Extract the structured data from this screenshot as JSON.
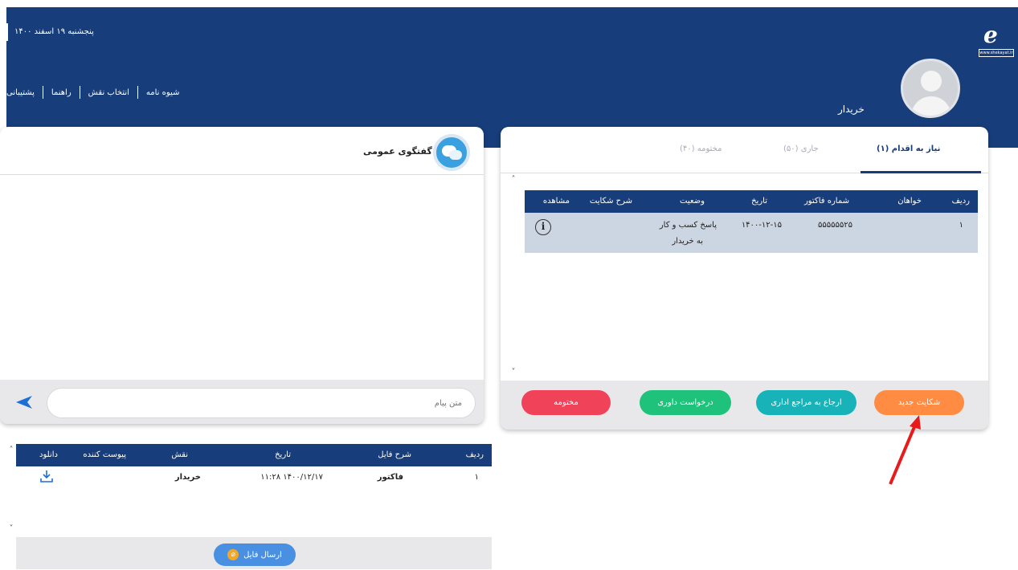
{
  "header": {
    "date": "پنجشنبه ۱۹ اسفند ۱۴۰۰",
    "nav": [
      "پشتیبانی",
      "راهنما",
      "انتخاب نقش",
      "شیوه نامه"
    ],
    "role": "خریدار",
    "logo_text": "www.shekayat.ir",
    "bg_color": "#173d7a"
  },
  "complaints": {
    "tabs": [
      {
        "label": "نیاز به اقدام (۱)",
        "active": true
      },
      {
        "label": "جاری (۵۰)",
        "active": false
      },
      {
        "label": "مختومه (۴۰)",
        "active": false
      }
    ],
    "columns": [
      "ردیف",
      "خواهان",
      "شماره فاکتور",
      "تاریخ",
      "وضعیت",
      "شرح شکایت",
      "مشاهده"
    ],
    "rows": [
      {
        "index": "۱",
        "plaintiff": "",
        "invoice": "۵۵۵۵۵۵۲۵",
        "date": "۱۴۰۰-۱۲-۱۵",
        "status_line1": "پاسخ کسب و کار",
        "status_line2": "به خریدار",
        "description": "",
        "view_icon": "info-icon"
      }
    ],
    "buttons": [
      {
        "label": "شکایت جدید",
        "color": "#ff8c42"
      },
      {
        "label": "ارجاع به مراجع اداری",
        "color": "#17b3b8"
      },
      {
        "label": "درخواست داوری",
        "color": "#1ec27a"
      },
      {
        "label": "مختومه",
        "color": "#f0435a"
      }
    ]
  },
  "chat": {
    "title": "گفتگوی عمومی",
    "placeholder": "متن پیام"
  },
  "files": {
    "columns": [
      "ردیف",
      "شرح فایل",
      "تاریخ",
      "نقش",
      "پیوست کننده",
      "دانلود"
    ],
    "rows": [
      {
        "index": "۱",
        "description": "فاکتور",
        "date": "۱۴۰۰/۱۲/۱۷ ۱۱:۲۸",
        "role": "خریدار",
        "uploader": ""
      }
    ],
    "send_button": "ارسال فایل"
  }
}
